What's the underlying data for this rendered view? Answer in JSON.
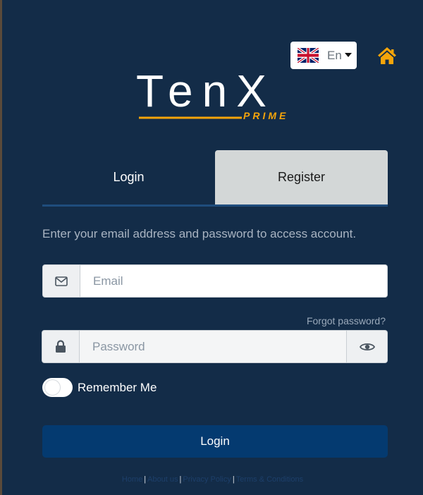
{
  "brand": {
    "name": "TenX",
    "tagline": "PRIME",
    "accent_color": "#f5a50a"
  },
  "language": {
    "selected": "En",
    "flag_icon": "uk-flag-icon",
    "caret_icon": "caret-down-icon"
  },
  "header": {
    "home_icon": "home-icon",
    "home_color": "#f5a50a"
  },
  "tabs": [
    {
      "label": "Login",
      "active": true
    },
    {
      "label": "Register",
      "active": false
    }
  ],
  "form": {
    "intro": "Enter your email address and password to access account.",
    "email": {
      "placeholder": "Email",
      "value": "",
      "icon": "envelope-icon"
    },
    "forgot_label": "Forgot password?",
    "password": {
      "placeholder": "Password",
      "value": "",
      "icon": "lock-icon",
      "toggle_icon": "eye-icon"
    },
    "remember_label": "Remember Me",
    "remember_checked": false,
    "submit_label": "Login"
  },
  "footer": {
    "links": [
      "Home",
      "About us",
      "Privacy Policy",
      "Terms & Conditions"
    ],
    "separator": "|"
  },
  "colors": {
    "background": "#132c48",
    "primary_button": "#043a70",
    "register_tab": "#d3d7d7"
  }
}
